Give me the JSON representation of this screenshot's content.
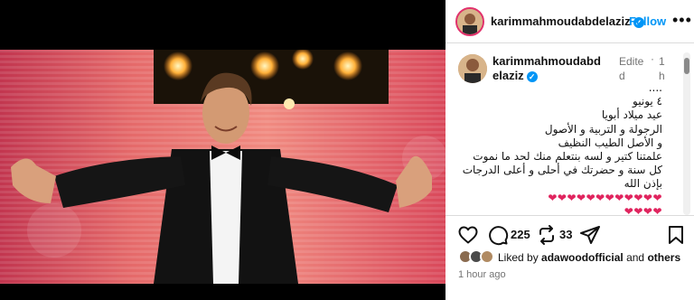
{
  "post": {
    "username": "karimmahmoudabdelaziz",
    "follow_label": "Follow",
    "more_label": "•••",
    "verified_mark": "✓",
    "edited_label": "Edited",
    "edited_sep": "·",
    "caption_time": "1h",
    "caption_lines": [
      "....",
      "٤ يونيو",
      "عيد ميلاد أبويا",
      "الرجولة و التربية و الأصول",
      "و الأصل الطيب النظيف",
      "علمتنا كتير و لسه بنتعلم منك لحد ما نموت",
      "كل سنة و حضرتك في أحلى و أعلى الدرجات",
      "بإذن الله",
      "❤❤❤❤❤❤❤❤❤❤❤❤",
      "❤❤❤❤"
    ],
    "likes_count": "225",
    "comments_count": "33",
    "liked_by_prefix": "Liked by",
    "liked_by_user": "adawoodofficial",
    "liked_by_and": "and",
    "liked_by_others": "others",
    "time_ago": "1 hour ago"
  },
  "icons": {
    "heart": "heart-icon",
    "comment": "comment-icon",
    "repost": "repost-icon",
    "share": "share-icon",
    "save": "bookmark-icon"
  },
  "colors": {
    "accent": "#0095f6",
    "heart": "#e0245e",
    "muted": "#737373"
  }
}
